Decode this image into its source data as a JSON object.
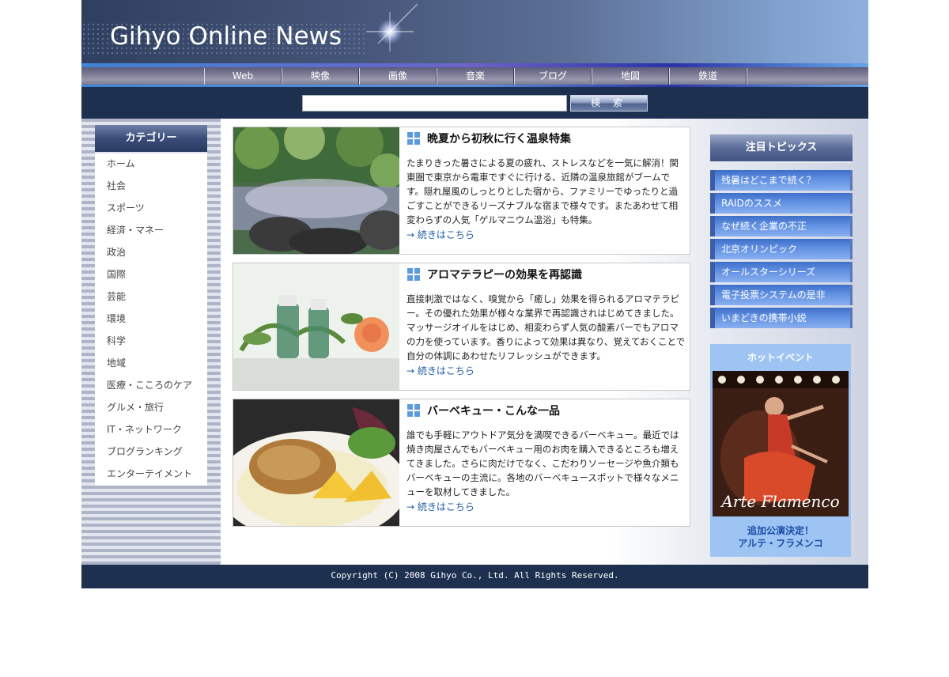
{
  "header": {
    "title": "Gihyo Online News"
  },
  "nav": {
    "items": [
      "Web",
      "映像",
      "画像",
      "音楽",
      "ブログ",
      "地図",
      "鉄道"
    ]
  },
  "search": {
    "value": "",
    "placeholder": "",
    "button_label": "検 索"
  },
  "categories": {
    "title": "カテゴリー",
    "items": [
      "ホーム",
      "社会",
      "スポーツ",
      "経済・マネー",
      "政治",
      "国際",
      "芸能",
      "環境",
      "科学",
      "地域",
      "医療・こころのケア",
      "グルメ・旅行",
      "IT・ネットワーク",
      "ブログランキング",
      "エンターテイメント"
    ]
  },
  "articles": [
    {
      "title": "晩夏から初秋に行く温泉特集",
      "body": "たまりきった暑さによる夏の疲れ、ストレスなどを一気に解消！関東圏で東京から電車ですぐに行ける、近隣の温泉旅館がブームです。隠れ屋風のしっとりとした宿から、ファミリーでゆったりと過ごすことができるリーズナブルな宿まで様々です。またあわせて相変わらずの人気「ゲルマニウム温浴」も特集。",
      "more": "→ 続きはこちら"
    },
    {
      "title": "アロマテラピーの効果を再認識",
      "body": "直接刺激ではなく、嗅覚から「癒し」効果を得られるアロマテラピー。その優れた効果が様々な業界で再認識されはじめてきました。マッサージオイルをはじめ、相変わらず人気の酸素バーでもアロマの力を使っています。香りによって効果は異なり、覚えておくことで自分の体調にあわせたリフレッシュができます。",
      "more": "→ 続きはこちら"
    },
    {
      "title": "バーベキュー・こんな一品",
      "body": "誰でも手軽にアウトドア気分を満喫できるバーベキュー。最近では焼き肉屋さんでもバーベキュー用のお肉を購入できるところも増えてきました。さらに肉だけでなく、こだわりソーセージや魚介類もバーベキューの主流に。各地のバーベキュースポットで様々なメニューを取材してきました。",
      "more": "→ 続きはこちら"
    }
  ],
  "topics": {
    "title": "注目トピックス",
    "items": [
      "残暑はどこまで続く？",
      "RAIDのススメ",
      "なぜ続く企業の不正",
      "北京オリンピック",
      "オールスターシリーズ",
      "電子投票システムの是非",
      "いまどきの携帯小説"
    ]
  },
  "event": {
    "title": "ホットイベント",
    "image_text": "Arte Flamenco",
    "caption_line1": "追加公演決定！",
    "caption_line2": "アルテ・フラメンコ"
  },
  "footer": {
    "copyright": "Copyright (C) 2008 Gihyo Co., Ltd. All Rights Reserved."
  },
  "colors": {
    "header_dark": "#2f3f5f",
    "navy_bar": "#1e3050",
    "link_blue": "#1b5ba6",
    "event_bg": "#9dc4f3",
    "topic_blue": "#3e6fc8"
  }
}
